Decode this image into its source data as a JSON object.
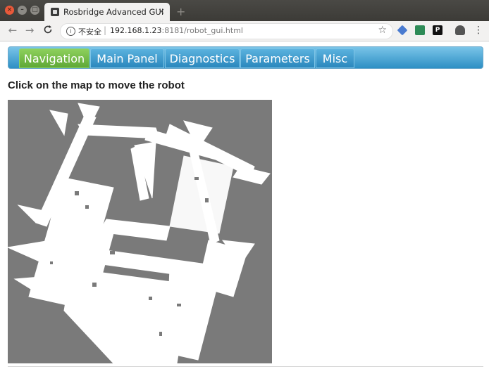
{
  "window": {
    "close_glyph": "×",
    "min_glyph": "–",
    "max_glyph": "□"
  },
  "tab": {
    "title": "Rosbridge Advanced GUI",
    "close_glyph": "×",
    "new_tab_glyph": "+",
    "favicon": "ros-favicon-icon"
  },
  "address_bar": {
    "back_glyph": "←",
    "forward_glyph": "→",
    "reload_glyph": "C",
    "info_glyph": "i",
    "security_label": "不安全",
    "separator": "|",
    "url_host": "192.168.1.23",
    "url_rest": ":8181/robot_gui.html",
    "star_glyph": "☆",
    "menu_glyph": "⋮",
    "extensions": [
      "bookmark-ext-icon",
      "pocket-ext-icon",
      "p-ext-icon",
      "profile-ext-icon"
    ],
    "ext_p_label": "P"
  },
  "navbar": {
    "tabs": [
      {
        "label": "Navigation",
        "active": true
      },
      {
        "label": "Main Panel",
        "active": false
      },
      {
        "label": "Diagnostics",
        "active": false
      },
      {
        "label": "Parameters",
        "active": false
      },
      {
        "label": "Misc",
        "active": false
      }
    ],
    "colors": {
      "active": "#6cb944",
      "inactive": "#2d8fc4"
    }
  },
  "main": {
    "heading": "Click on the map to move the robot",
    "map_background": "#7a7a7a",
    "map_free_color": "#ffffff"
  }
}
